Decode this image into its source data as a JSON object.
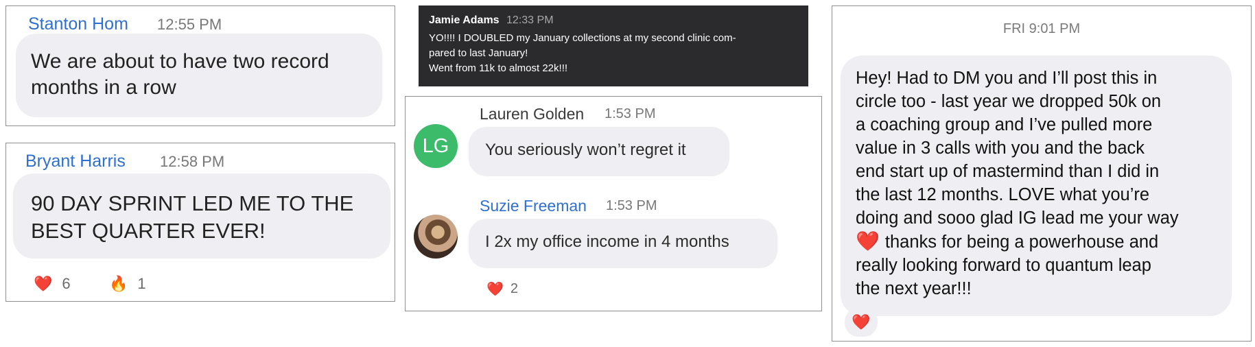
{
  "card1": {
    "sender": "Stanton Hom",
    "time": "12:55 PM",
    "message_line1": "We are about to have two record",
    "message_line2": "months in a row"
  },
  "card2": {
    "sender": "Bryant Harris",
    "time": "12:58 PM",
    "message_line1": "90 DAY SPRINT LED ME TO THE",
    "message_line2": "BEST QUARTER EVER!",
    "reactions": [
      {
        "emoji": "❤️",
        "icon": "heart-icon",
        "count": "6"
      },
      {
        "emoji": "🔥",
        "icon": "fire-icon",
        "count": "1"
      }
    ]
  },
  "card3": {
    "sender": "Jamie Adams",
    "time": "12:33 PM",
    "line1": "YO!!!! I DOUBLED my January collections at my second clinic com-",
    "line2": "pared to last January!",
    "line3": "Went from 11k to almost 22k!!!"
  },
  "card4": {
    "msg1": {
      "avatar_initials": "LG",
      "avatar_color": "#3cbb6a",
      "sender": "Lauren Golden",
      "time": "1:53 PM",
      "message": "You seriously won’t regret it"
    },
    "msg2": {
      "sender": "Suzie Freeman",
      "time": "1:53 PM",
      "message": "I 2x my office income in 4 months",
      "reaction": {
        "emoji": "❤️",
        "icon": "heart-icon",
        "count": "2"
      }
    }
  },
  "card5": {
    "timestamp": "FRI 9:01 PM",
    "lines": [
      "Hey! Had to DM you and I’ll post this in",
      "circle too -  last year we dropped 50k on",
      "a coaching group and I’ve pulled more",
      "value in 3 calls with you and the back",
      "end start up of mastermind than I did in",
      "the last 12 months.  LOVE what you’re",
      "doing and sooo glad IG lead me your way",
      "thanks for being a powerhouse and",
      "really looking forward to quantum leap",
      "the next year!!!"
    ],
    "inline_emoji": "❤️",
    "reaction_emoji": "❤️"
  }
}
